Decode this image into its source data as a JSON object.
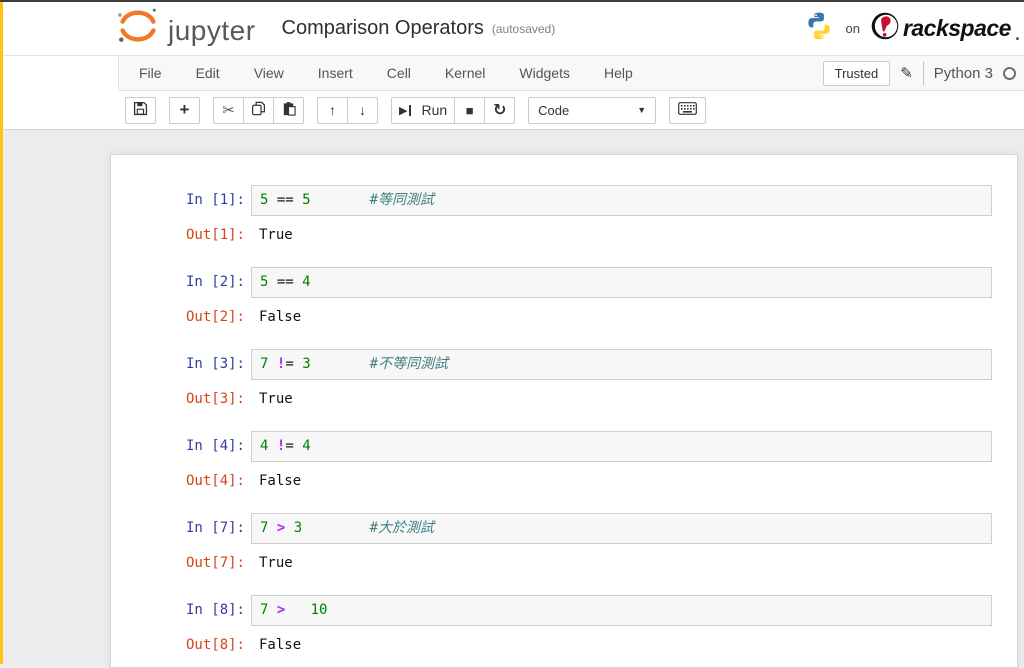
{
  "colors": {
    "accent-bar": "#FFC20E",
    "in-prompt": "#303F9F",
    "out-prompt": "#D84315",
    "code-number": "#008000",
    "code-operator": "#AA22FF",
    "code-comment": "#408080",
    "jupyter-orange": "#F37726",
    "rackspace-red": "#C8102E",
    "python-blue": "#3776AB",
    "python-yellow": "#FFD43B"
  },
  "header": {
    "logo_text": "jupyter",
    "title": "Comparison Operators",
    "autosaved": "(autosaved)",
    "on_label": "on",
    "rackspace_label": "rackspace",
    "rackspace_dot": "."
  },
  "menu": {
    "items": [
      "File",
      "Edit",
      "View",
      "Insert",
      "Cell",
      "Kernel",
      "Widgets",
      "Help"
    ],
    "trusted_label": "Trusted",
    "kernel_name": "Python 3"
  },
  "toolbar": {
    "run_label": "Run",
    "cell_type_value": "Code"
  },
  "icons": {
    "add": "+",
    "cut": "✂",
    "move_up": "↑",
    "move_down": "↓",
    "run_play": "▶",
    "stop": "■",
    "restart": "↻",
    "dropdown": "▼",
    "pencil": "✎"
  },
  "notebook": {
    "cells": [
      {
        "in_prompt": "In [1]:",
        "out_prompt": "Out[1]:",
        "output": "True",
        "tokens": [
          {
            "t": "5",
            "k": "num"
          },
          {
            "t": " ",
            "k": "plain"
          },
          {
            "t": "==",
            "k": "punct"
          },
          {
            "t": " ",
            "k": "plain"
          },
          {
            "t": "5",
            "k": "num"
          },
          {
            "t": "       ",
            "k": "plain"
          },
          {
            "t": "#等同測試",
            "k": "comment"
          }
        ]
      },
      {
        "in_prompt": "In [2]:",
        "out_prompt": "Out[2]:",
        "output": "False",
        "tokens": [
          {
            "t": "5",
            "k": "num"
          },
          {
            "t": " ",
            "k": "plain"
          },
          {
            "t": "==",
            "k": "punct"
          },
          {
            "t": " ",
            "k": "plain"
          },
          {
            "t": "4",
            "k": "num"
          }
        ]
      },
      {
        "in_prompt": "In [3]:",
        "out_prompt": "Out[3]:",
        "output": "True",
        "tokens": [
          {
            "t": "7",
            "k": "num"
          },
          {
            "t": " ",
            "k": "plain"
          },
          {
            "t": "!",
            "k": "op"
          },
          {
            "t": "=",
            "k": "punct"
          },
          {
            "t": " ",
            "k": "plain"
          },
          {
            "t": "3",
            "k": "num"
          },
          {
            "t": "       ",
            "k": "plain"
          },
          {
            "t": "#不等同測試",
            "k": "comment"
          }
        ]
      },
      {
        "in_prompt": "In [4]:",
        "out_prompt": "Out[4]:",
        "output": "False",
        "tokens": [
          {
            "t": "4",
            "k": "num"
          },
          {
            "t": " ",
            "k": "plain"
          },
          {
            "t": "!",
            "k": "op"
          },
          {
            "t": "=",
            "k": "punct"
          },
          {
            "t": " ",
            "k": "plain"
          },
          {
            "t": "4",
            "k": "num"
          }
        ]
      },
      {
        "in_prompt": "In [7]:",
        "out_prompt": "Out[7]:",
        "output": "True",
        "tokens": [
          {
            "t": "7",
            "k": "num"
          },
          {
            "t": " ",
            "k": "plain"
          },
          {
            "t": ">",
            "k": "op"
          },
          {
            "t": " ",
            "k": "plain"
          },
          {
            "t": "3",
            "k": "num"
          },
          {
            "t": "        ",
            "k": "plain"
          },
          {
            "t": "#大於測試",
            "k": "comment"
          }
        ]
      },
      {
        "in_prompt": "In [8]:",
        "out_prompt": "Out[8]:",
        "output": "False",
        "tokens": [
          {
            "t": "7",
            "k": "num"
          },
          {
            "t": " ",
            "k": "plain"
          },
          {
            "t": ">",
            "k": "op"
          },
          {
            "t": "   ",
            "k": "plain"
          },
          {
            "t": "10",
            "k": "num"
          }
        ]
      }
    ]
  }
}
